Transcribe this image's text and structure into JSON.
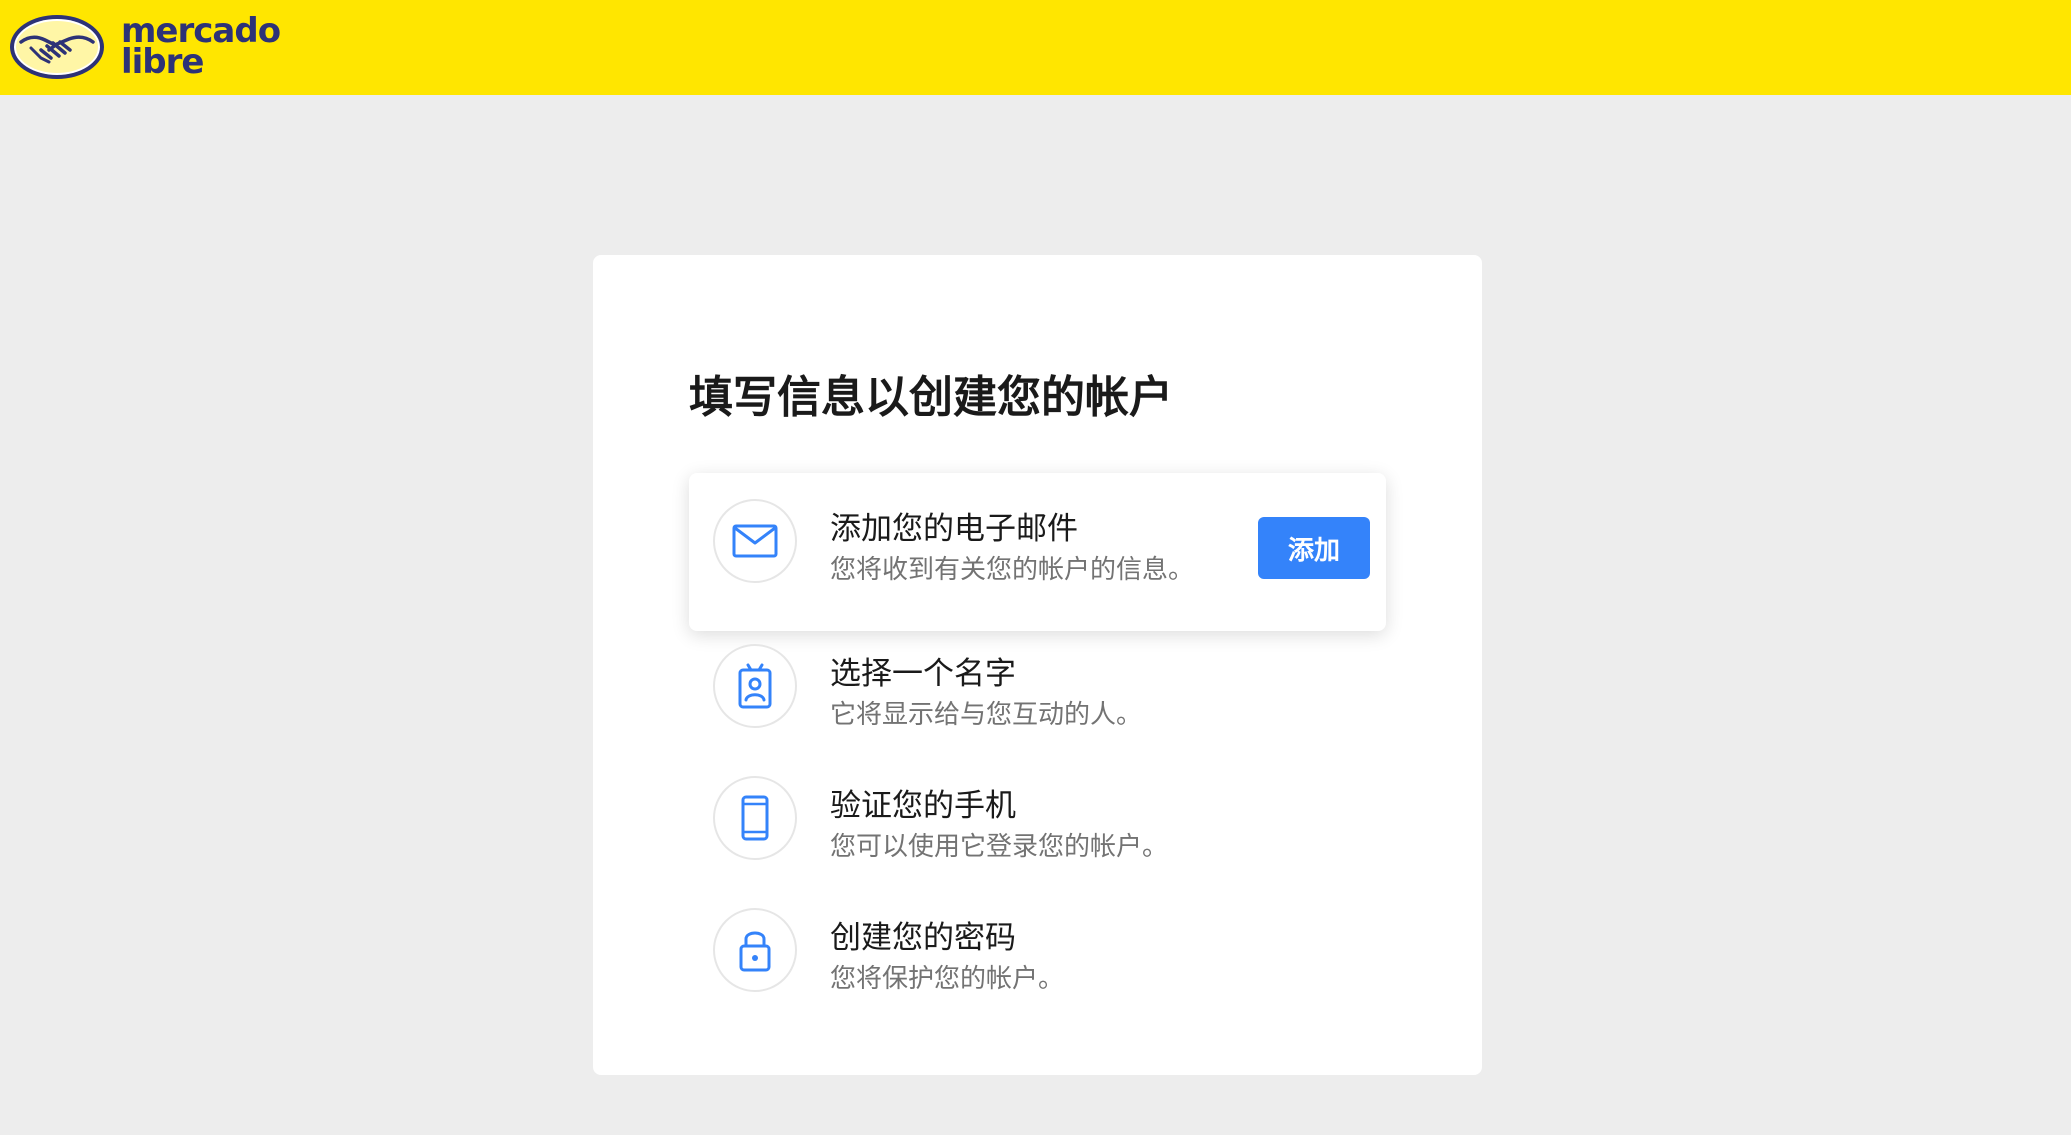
{
  "brand": {
    "name_line1": "mercado",
    "name_line2": "libre",
    "bar_color": "#ffe600",
    "text_color": "#2d3277"
  },
  "page": {
    "title": "填写信息以创建您的帐户"
  },
  "steps": [
    {
      "icon": "mail-icon",
      "title": "添加您的电子邮件",
      "subtitle": "您将收到有关您的帐户的信息。",
      "button_label": "添加"
    },
    {
      "icon": "id-badge-icon",
      "title": "选择一个名字",
      "subtitle": "它将显示给与您互动的人。"
    },
    {
      "icon": "phone-icon",
      "title": "验证您的手机",
      "subtitle": "您可以使用它登录您的帐户。"
    },
    {
      "icon": "lock-icon",
      "title": "创建您的密码",
      "subtitle": "您将保护您的帐户。"
    }
  ],
  "colors": {
    "accent": "#3483fa",
    "background": "#ededed"
  }
}
